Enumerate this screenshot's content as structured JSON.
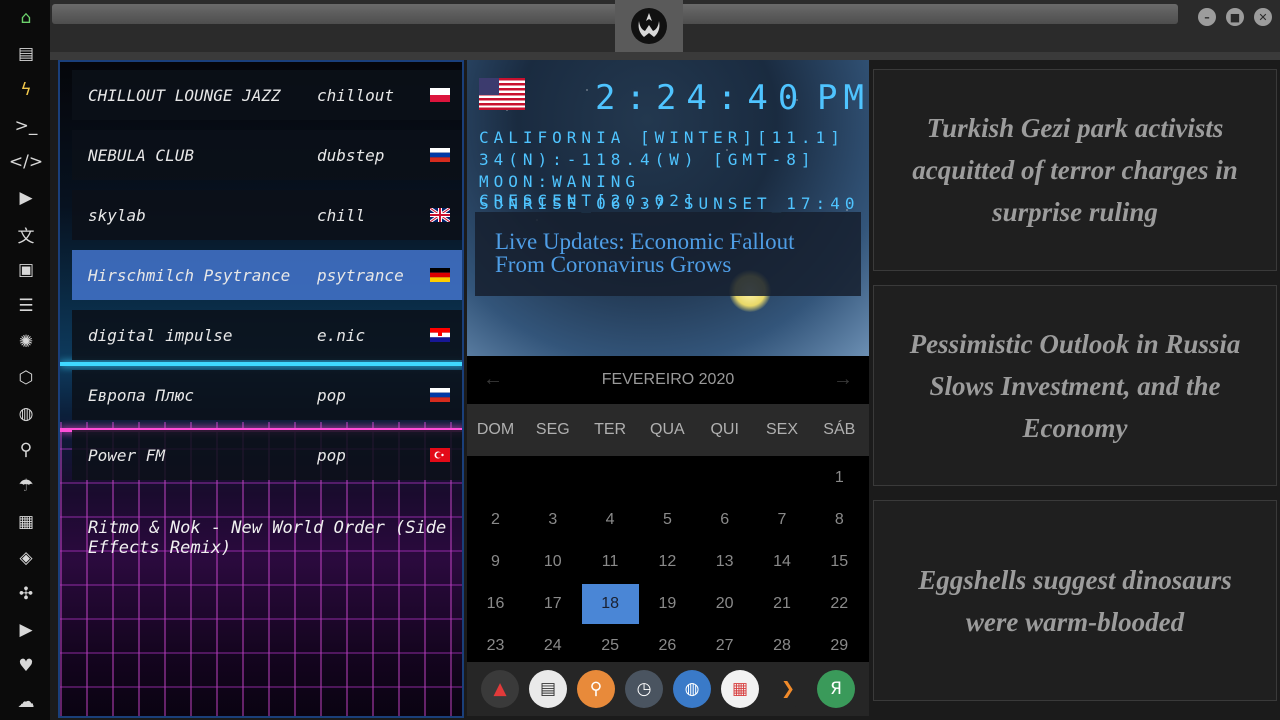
{
  "dock": {
    "icons": [
      "home-icon",
      "document-icon",
      "bolt-icon",
      "terminal-icon",
      "code-icon",
      "play-icon",
      "translate-icon",
      "image-icon",
      "news-icon",
      "settings-wheel-icon",
      "hexagon-icon",
      "globe-icon",
      "search-icon",
      "umbrella-icon",
      "contact-icon",
      "git-icon",
      "expand-icon",
      "youtube-icon",
      "heart-icon",
      "cloud-icon"
    ]
  },
  "radio": {
    "stations": [
      {
        "name": "CHILLOUT LOUNGE JAZZ",
        "genre": "chillout",
        "flag": "poland"
      },
      {
        "name": "NEBULA CLUB",
        "genre": "dubstep",
        "flag": "russia"
      },
      {
        "name": "skylab",
        "genre": "chill",
        "flag": "uk"
      },
      {
        "name": "Hirschmilch Psytrance",
        "genre": "psytrance",
        "flag": "germany"
      },
      {
        "name": "digital impulse",
        "genre": "e.nic",
        "flag": "croatia"
      },
      {
        "name": "Европа Плюс",
        "genre": "pop",
        "flag": "russia"
      },
      {
        "name": "Power FM",
        "genre": "pop",
        "flag": "turkey"
      }
    ],
    "active_index": 3,
    "now_playing": "Ritmo & Nok - New World Order (Side Effects Remix)"
  },
  "clock": {
    "time": "2:24:40",
    "ampm": "PM",
    "location": "CALIFORNIA [WINTER][11.1]",
    "coords": "34(N):-118.4(W) [GMT-8]",
    "moon": "MOON:WANING CRESCENT[20.02]",
    "sun": "SUNRISE_06:37 SUNSET_17:40",
    "headline": "Live Updates: Economic Fallout From Coronavirus Grows"
  },
  "calendar": {
    "month": "FEVEREIRO 2020",
    "prev": "←",
    "next": "→",
    "days": [
      "DOM",
      "SEG",
      "TER",
      "QUA",
      "QUI",
      "SEX",
      "SÁB"
    ],
    "weeks": [
      [
        "",
        "",
        "",
        "",
        "",
        "",
        "1"
      ],
      [
        "2",
        "3",
        "4",
        "5",
        "6",
        "7",
        "8"
      ],
      [
        "9",
        "10",
        "11",
        "12",
        "13",
        "14",
        "15"
      ],
      [
        "16",
        "17",
        "18",
        "19",
        "20",
        "21",
        "22"
      ],
      [
        "23",
        "24",
        "25",
        "26",
        "27",
        "28",
        "29"
      ]
    ],
    "today": "18"
  },
  "appbar": {
    "apps": [
      {
        "name": "arch-app-icon",
        "color": "#3a3a3a",
        "fg": "#e23a3a"
      },
      {
        "name": "newspaper-app-icon",
        "color": "#eaeaea",
        "fg": "#333333"
      },
      {
        "name": "search-app-icon",
        "color": "#e88a3a",
        "fg": "#ffffff"
      },
      {
        "name": "clock-app-icon",
        "color": "#4a5460",
        "fg": "#ffffff"
      },
      {
        "name": "browser-app-icon",
        "color": "#3a7ac8",
        "fg": "#ffffff"
      },
      {
        "name": "calendar-app-icon",
        "color": "#f2f2f2",
        "fg": "#d84040"
      },
      {
        "name": "play-app-icon",
        "color": "#262626",
        "fg": "#f08a2a"
      },
      {
        "name": "yandex-app-icon",
        "color": "#3a9a5a",
        "fg": "#ffffff"
      }
    ]
  },
  "news": [
    "Turkish Gezi park activists acquitted of terror charges in surprise ruling",
    "Pessimistic Outlook in Russia Slows Investment, and the Economy",
    "Eggshells suggest dinosaurs were warm-blooded"
  ],
  "colors": {
    "accent": "#4a86d6",
    "digital": "#4fc4ff",
    "news_text": "#9c9c9c"
  }
}
